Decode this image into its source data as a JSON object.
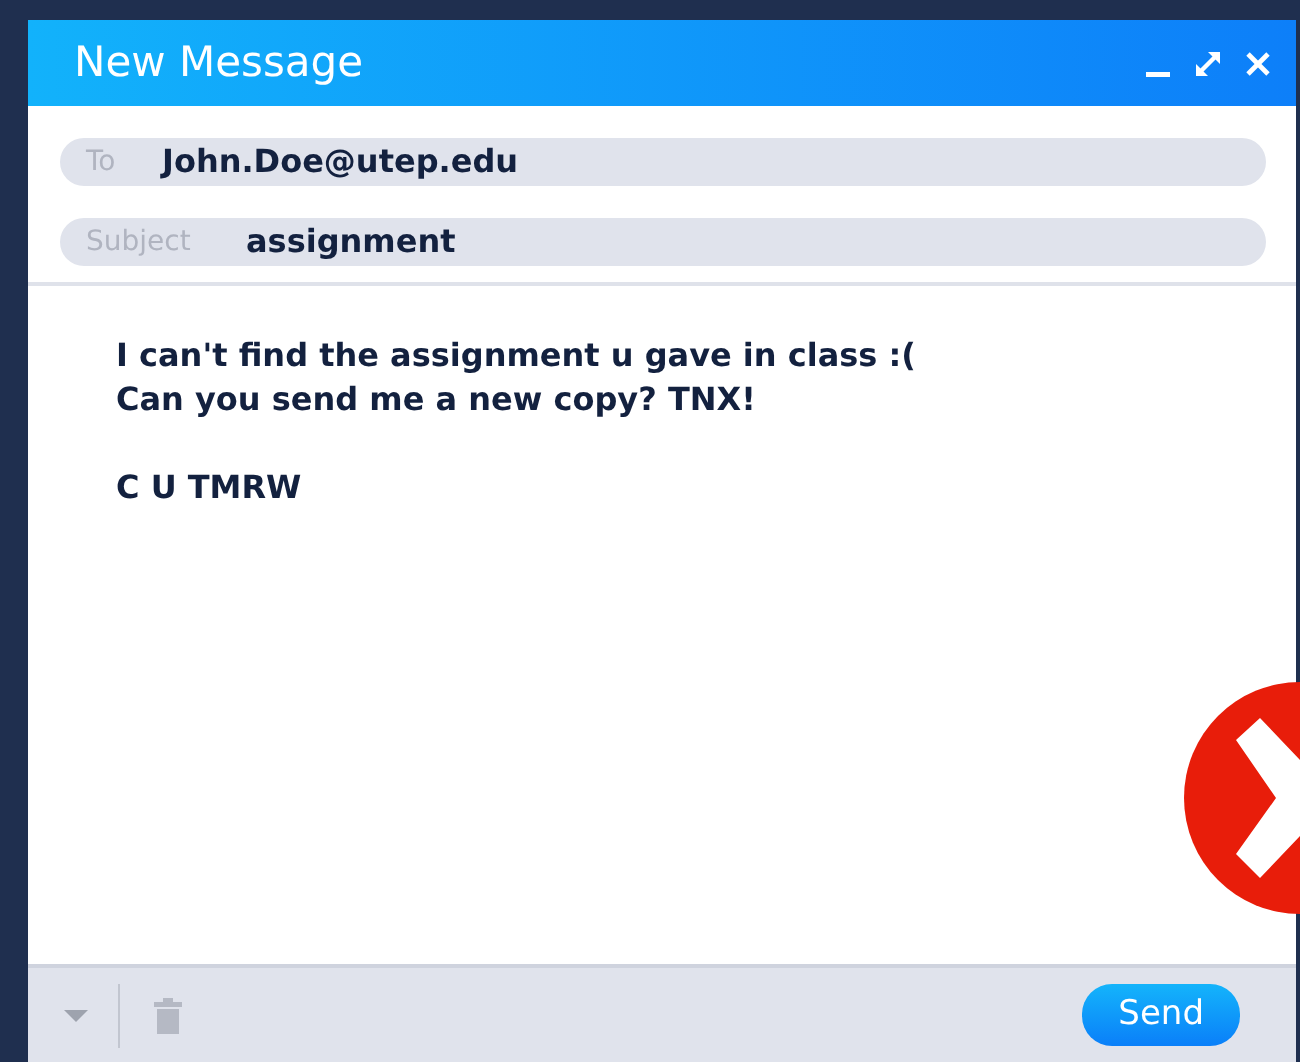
{
  "window": {
    "title": "New Message"
  },
  "fields": [
    {
      "label": "To",
      "value": "John.Doe@utep.edu"
    },
    {
      "label": "Subject",
      "value": "assignment"
    }
  ],
  "body": {
    "paragraphs": [
      [
        "I can't find the assignment u gave in class :(",
        "Can you send me a new copy? TNX!"
      ],
      [
        "C U TMRW"
      ]
    ]
  },
  "footer": {
    "send": "Send"
  }
}
